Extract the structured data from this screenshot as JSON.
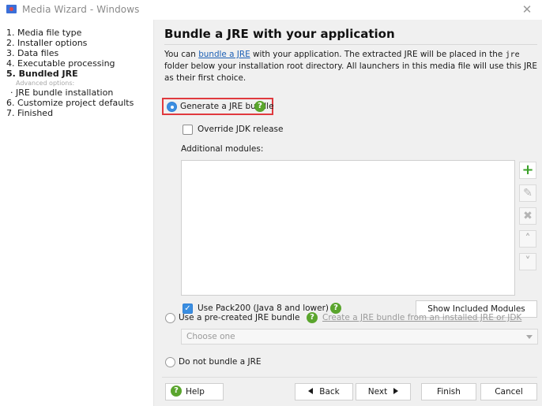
{
  "window": {
    "title": "Media Wizard - Windows",
    "close_glyph": "✕",
    "app_icon": "media-wizard-icon"
  },
  "sidebar": {
    "steps": [
      {
        "label": "1. Media file type",
        "active": false
      },
      {
        "label": "2. Installer options",
        "active": false
      },
      {
        "label": "3. Data files",
        "active": false
      },
      {
        "label": "4. Executable processing",
        "active": false
      },
      {
        "label": "5. Bundled JRE",
        "active": true
      }
    ],
    "advanced_label": "Advanced options:",
    "advanced_items": [
      {
        "label": "·  JRE bundle installation"
      }
    ],
    "later_steps": [
      {
        "label": "6. Customize project defaults"
      },
      {
        "label": "7. Finished"
      }
    ]
  },
  "main": {
    "heading": "Bundle a JRE with your application",
    "desc_prefix": "You can ",
    "desc_link": "bundle a JRE",
    "desc_middle": " with your application. The extracted JRE will be placed in the ",
    "desc_code": "jre",
    "desc_suffix": " folder below your installation root directory. All launchers in this media file will use this JRE as their first choice.",
    "options": {
      "generate": {
        "label": "Generate a JRE bundle",
        "selected": true
      },
      "precreated": {
        "label": "Use a pre-created JRE bundle",
        "selected": false,
        "link": "Create a JRE bundle from an installed JRE or JDK"
      },
      "none": {
        "label": "Do not bundle a JRE",
        "selected": false
      }
    },
    "override_jdk": {
      "label": "Override JDK release",
      "checked": false
    },
    "modules_label": "Additional modules:",
    "modules": [],
    "list_buttons": {
      "add": "+",
      "edit": "✎",
      "remove": "✖",
      "up": "˄",
      "down": "˅"
    },
    "pack200": {
      "label": "Use Pack200 (Java 8 and lower)",
      "checked": true
    },
    "show_modules_button": "Show Included Modules",
    "combo_placeholder": "Choose one",
    "help_glyph": "?",
    "check_glyph": "✓"
  },
  "footer": {
    "help": "Help",
    "back": "Back",
    "next": "Next",
    "finish": "Finish",
    "cancel": "Cancel"
  },
  "colors": {
    "accent": "#3b8ee0",
    "help_green": "#5aa52d",
    "highlight_red": "#e0393e",
    "link_blue": "#1b5fb5"
  }
}
